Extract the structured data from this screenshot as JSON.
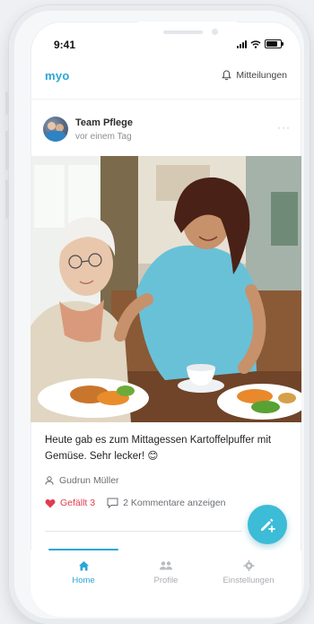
{
  "status_bar": {
    "time": "9:41"
  },
  "header": {
    "logo": "myo",
    "notifications_label": "Mitteilungen"
  },
  "post": {
    "author_name": "Team Pflege",
    "timestamp": "vor einem Tag",
    "more_label": "···",
    "caption": "Heute gab es zum Mittagessen Kartoffelpuffer mit Gemüse. Sehr lecker! 😊",
    "resident": "Gudrun Müller",
    "likes_label": "Gefällt 3",
    "comments_label": "2 Kommentare anzeigen"
  },
  "tabs": [
    {
      "label": "Home",
      "icon": "home-icon",
      "active": true
    },
    {
      "label": "Profile",
      "icon": "people-icon",
      "active": false
    },
    {
      "label": "Einstellungen",
      "icon": "gear-icon",
      "active": false
    }
  ],
  "colors": {
    "accent": "#29a7d6",
    "fab": "#3cbcd7",
    "like": "#e03c4f"
  }
}
